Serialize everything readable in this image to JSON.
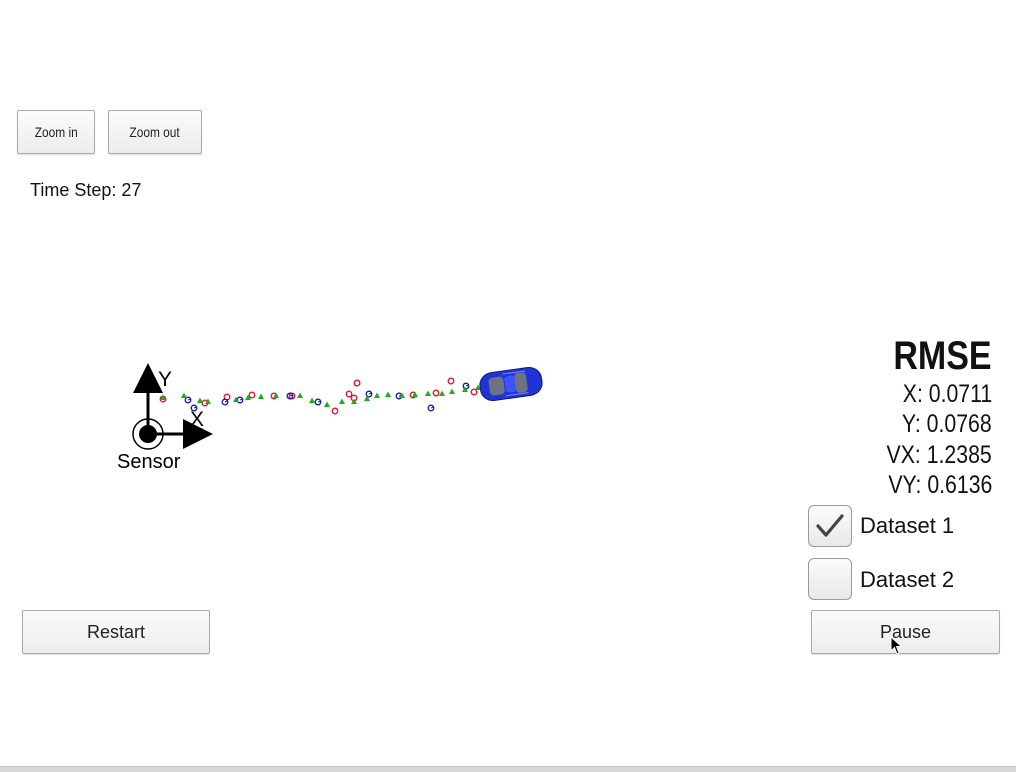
{
  "toolbar": {
    "zoom_in_label": "Zoom in",
    "zoom_out_label": "Zoom out"
  },
  "status": {
    "time_step_label": "Time Step:",
    "time_step_value": "27"
  },
  "axes": {
    "y_label": "Y",
    "x_label": "X",
    "origin_label": "Sensor"
  },
  "rmse": {
    "title": "RMSE",
    "x": "X: 0.0711",
    "y": "Y: 0.0768",
    "vx": "VX: 1.2385",
    "vy": "VY: 0.6136"
  },
  "datasets": [
    {
      "label": "Dataset 1",
      "checked": true
    },
    {
      "label": "Dataset 2",
      "checked": false
    }
  ],
  "controls": {
    "restart_label": "Restart",
    "pause_label": "Pause"
  },
  "colors": {
    "lidar": "#e8112d",
    "radar": "#1a1aa8",
    "estimate": "#16b01a",
    "car": "#2233d6"
  },
  "icons": {
    "checkmark": "checkmark-icon",
    "car": "car-icon",
    "cursor": "mouse-cursor-icon"
  }
}
